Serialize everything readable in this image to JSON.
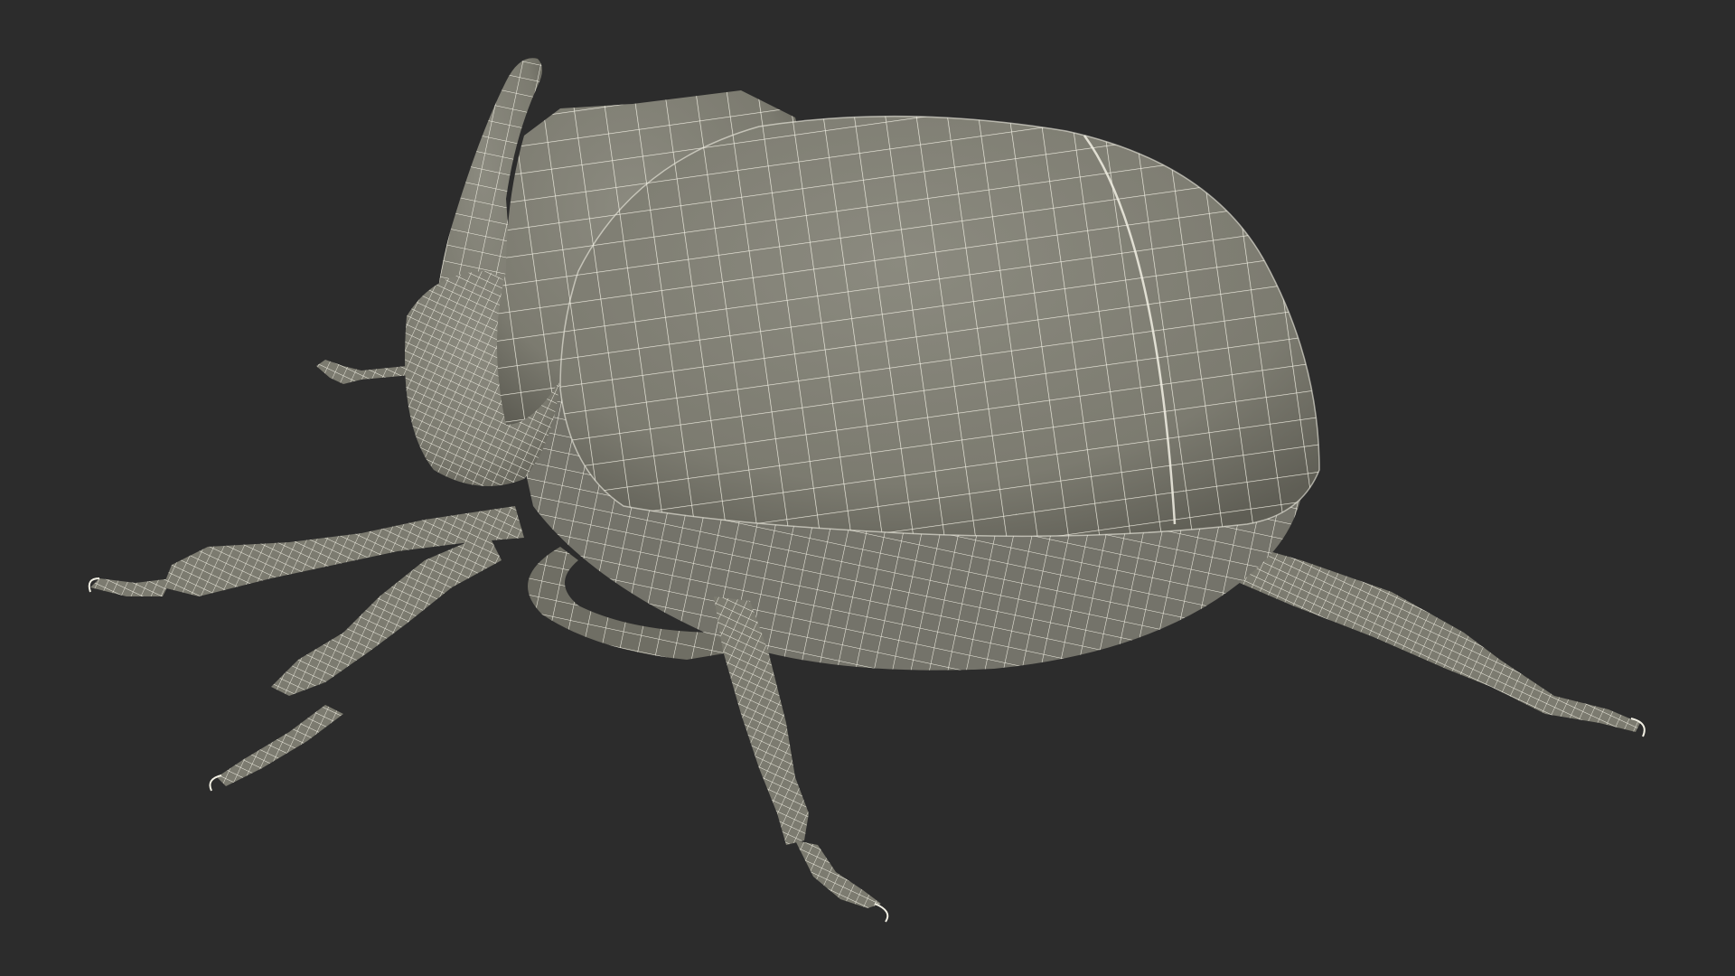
{
  "render": {
    "background_color": "#2c2c2c",
    "shell_color": "#7c7b70",
    "shell_shadow_color": "#5f5e55",
    "shell_highlight_color": "#8b8a7f",
    "wireframe_color": "#f2f0e4",
    "underside_shadow_color": "#1f1f1f"
  },
  "subject": {
    "icon": "beetle-icon",
    "parts": [
      "horn",
      "head",
      "antenna",
      "pronotum",
      "elytra",
      "abdomen",
      "legs"
    ]
  }
}
